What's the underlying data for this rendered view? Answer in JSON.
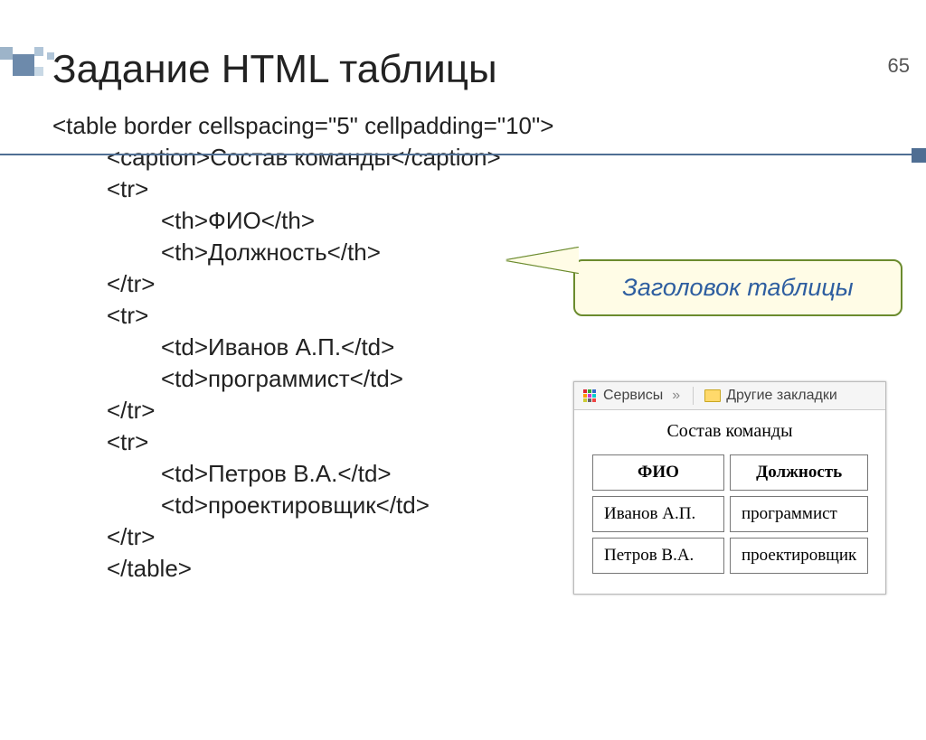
{
  "slide_number": "65",
  "title": "Задание HTML таблицы",
  "code": {
    "l1": "<table border cellspacing=\"5\" cellpadding=\"10\">",
    "l2": "<caption>Состав команды</caption>",
    "l3": "<tr>",
    "l4": "<th>ФИО</th>",
    "l5": "<th>Должность</th>",
    "l6": "</tr>",
    "l7": "<tr>",
    "l8": "<td>Иванов А.П.</td>",
    "l9": "<td>программист</td>",
    "l10": "</tr>",
    "l11": "<tr>",
    "l12": "<td>Петров В.А.</td>",
    "l13": "<td>проектировщик</td>",
    "l14": "</tr>",
    "l15": "</table>"
  },
  "callout_text": "Заголовок таблицы",
  "browser": {
    "services_label": "Сервисы",
    "chevrons": "»",
    "other_bookmarks_label": "Другие закладки"
  },
  "table": {
    "caption": "Состав команды",
    "headers": [
      "ФИО",
      "Должность"
    ],
    "rows": [
      [
        "Иванов А.П.",
        "программист"
      ],
      [
        "Петров В.А.",
        "проектировщик"
      ]
    ]
  }
}
